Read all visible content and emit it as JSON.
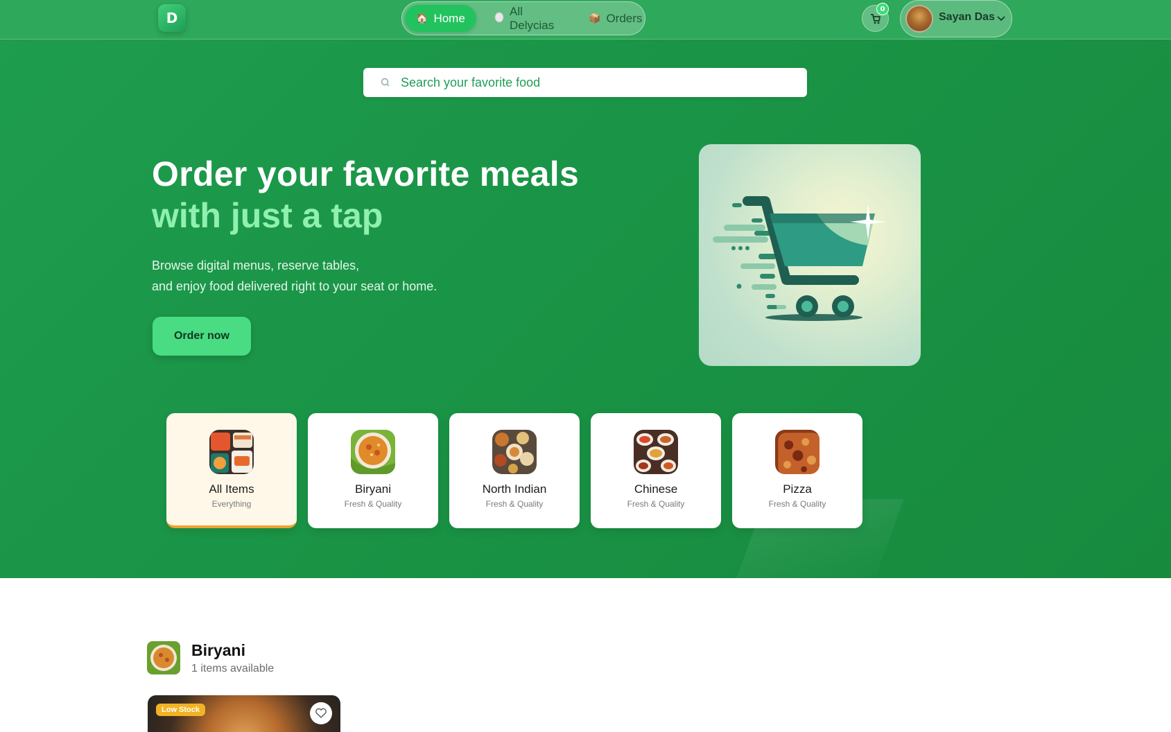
{
  "nav": {
    "logo_letter": "D",
    "items": [
      {
        "label": "Home",
        "icon": "home-icon",
        "active": true
      },
      {
        "label": "All Delycias",
        "icon": "tray-icon",
        "active": false
      },
      {
        "label": "Orders",
        "icon": "box-icon",
        "active": false
      }
    ],
    "cart_count": "0",
    "user_name": "Sayan Das"
  },
  "search": {
    "placeholder": "Search your favorite food"
  },
  "hero": {
    "title_line1": "Order your favorite meals",
    "title_line2": "with just a tap",
    "subtitle_line1": "Browse digital menus, reserve tables,",
    "subtitle_line2": "and enjoy food delivered right to your seat or home.",
    "cta_label": "Order now",
    "colors": {
      "accent": "#8ff0b0",
      "hero_bg": "#1a9446",
      "cta_bg": "#49dc82"
    }
  },
  "categories": [
    {
      "name": "All Items",
      "sub": "Everything",
      "active": true
    },
    {
      "name": "Biryani",
      "sub": "Fresh & Quality",
      "active": false
    },
    {
      "name": "North Indian",
      "sub": "Fresh & Quality",
      "active": false
    },
    {
      "name": "Chinese",
      "sub": "Fresh & Quality",
      "active": false
    },
    {
      "name": "Pizza",
      "sub": "Fresh & Quality",
      "active": false
    }
  ],
  "section": {
    "title": "Biryani",
    "count_text": "1 items available",
    "item": {
      "badge": "Low Stock"
    }
  }
}
